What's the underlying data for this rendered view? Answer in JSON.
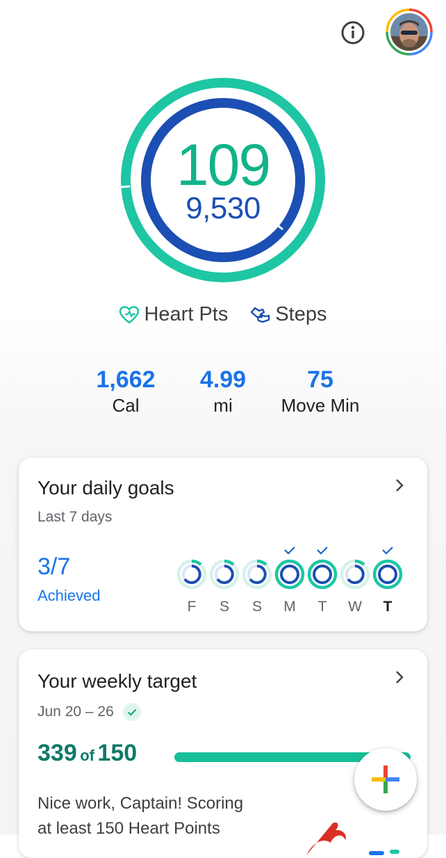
{
  "header": {
    "info_icon": "info-icon",
    "avatar_icon": "profile-avatar"
  },
  "rings": {
    "heart_points": "109",
    "steps": "9,530",
    "heart_color": "#1ec6a4",
    "steps_color": "#1c4fb3"
  },
  "legend": {
    "heart_label": "Heart Pts",
    "steps_label": "Steps",
    "heart_icon": "heart-points-icon",
    "steps_icon": "steps-icon"
  },
  "stats": [
    {
      "value": "1,662",
      "label": "Cal"
    },
    {
      "value": "4.99",
      "label": "mi"
    },
    {
      "value": "75",
      "label": "Move Min"
    }
  ],
  "daily_goals": {
    "title": "Your daily goals",
    "subtitle": "Last 7 days",
    "achieved_count": "3/7",
    "achieved_label": "Achieved",
    "days": [
      {
        "label": "F",
        "met": false,
        "today": false
      },
      {
        "label": "S",
        "met": false,
        "today": false
      },
      {
        "label": "S",
        "met": false,
        "today": false
      },
      {
        "label": "M",
        "met": true,
        "today": false
      },
      {
        "label": "T",
        "met": true,
        "today": false
      },
      {
        "label": "W",
        "met": false,
        "today": false
      },
      {
        "label": "T",
        "met": true,
        "today": true
      }
    ]
  },
  "weekly_target": {
    "title": "Your weekly target",
    "date_range": "Jun 20 – 26",
    "score": "339",
    "of_text": "of",
    "target": "150",
    "progress_fraction": 1.0,
    "message_line1": "Nice work, Captain! Scoring",
    "message_line2": "at least 150 Heart Points"
  },
  "fab": {
    "icon": "add-icon"
  }
}
